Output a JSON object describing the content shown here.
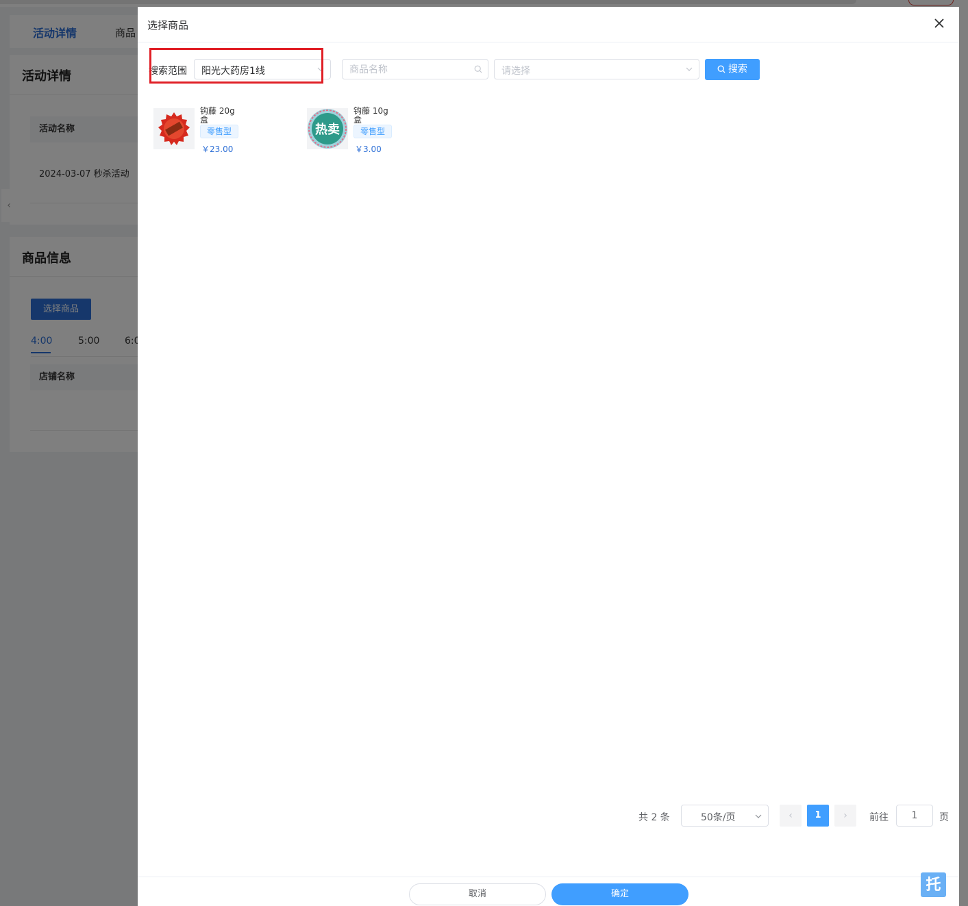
{
  "background": {
    "tabs": {
      "active": "活动详情",
      "other": "商品"
    },
    "section1": {
      "title": "活动详情",
      "column_header": "活动名称",
      "cell": "2024-03-07 秒杀活动"
    },
    "section2": {
      "title": "商品信息",
      "select_button": "选择商品",
      "times": [
        "4:00",
        "5:00",
        "6:0"
      ],
      "column_header": "店铺名称"
    },
    "collapse_glyph": "‹"
  },
  "dialog": {
    "title": "选择商品",
    "search": {
      "scope_label": "搜索范围",
      "scope_value": "阳光大药房1线",
      "name_placeholder": "商品名称",
      "category_placeholder": "请选择",
      "button_label": "搜索"
    },
    "products": [
      {
        "name": "钩藤 20g",
        "unit": "盒",
        "tag": "零售型",
        "price": "￥23.00",
        "thumb_icon": "promo-badge-icon"
      },
      {
        "name": "钩藤 10g",
        "unit": "盒",
        "tag": "零售型",
        "price": "￥3.00",
        "thumb_icon": "hot-sale-badge-icon",
        "thumb_text": "热卖"
      }
    ],
    "pagination": {
      "total": "共 2 条",
      "page_size": "50条/页",
      "prev": "‹",
      "current": "1",
      "next": "›",
      "goto_label": "前往",
      "goto_value": "1",
      "page_suffix": "页"
    },
    "footer": {
      "cancel": "取消",
      "confirm": "确定"
    }
  },
  "float_badge": "托",
  "colors": {
    "primary": "#409eff",
    "highlight": "#e01f26",
    "brand_blue": "#2d6fd6"
  }
}
